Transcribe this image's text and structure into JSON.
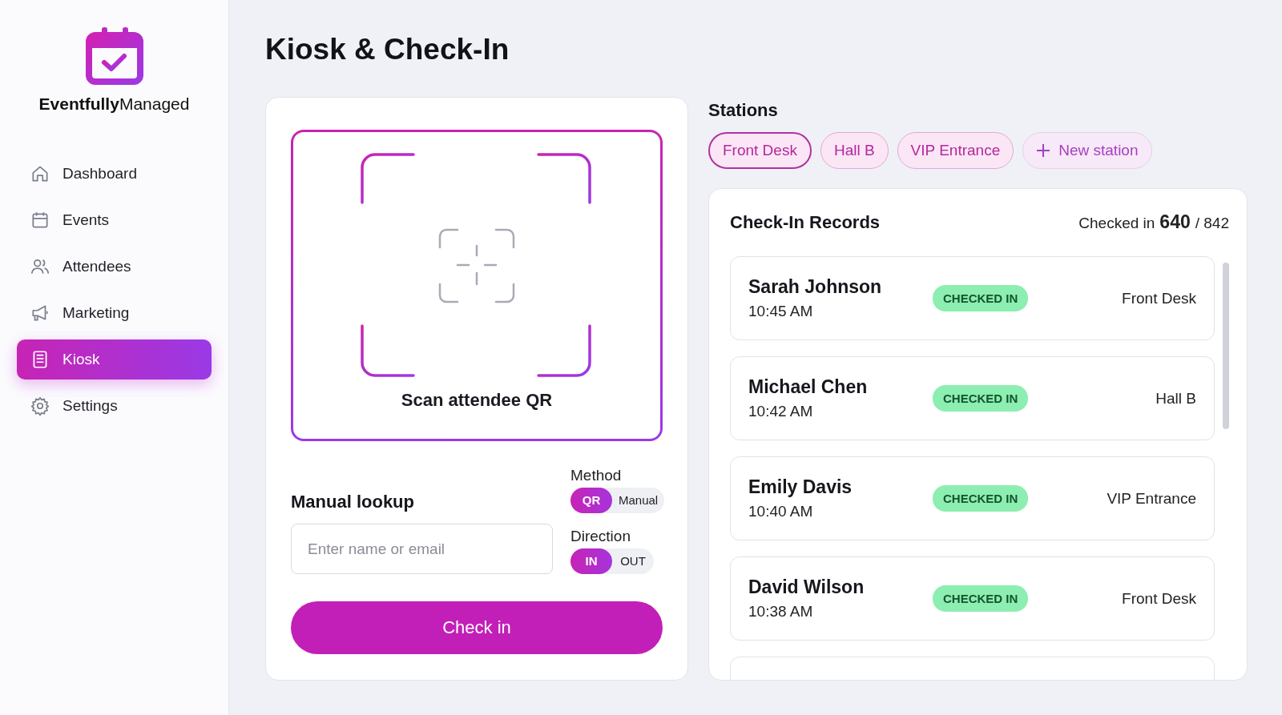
{
  "brand": {
    "name_bold": "Eventfully",
    "name_rest": "Managed"
  },
  "nav": [
    {
      "label": "Dashboard",
      "kind": "home",
      "selected": false
    },
    {
      "label": "Events",
      "kind": "calendar",
      "selected": false
    },
    {
      "label": "Attendees",
      "kind": "users",
      "selected": false
    },
    {
      "label": "Marketing",
      "kind": "megaphone",
      "selected": false
    },
    {
      "label": "Kiosk",
      "kind": "kiosk",
      "selected": true
    },
    {
      "label": "Settings",
      "kind": "gear",
      "selected": false
    }
  ],
  "page_title": "Kiosk & Check-In",
  "scanner": {
    "caption": "Scan attendee QR"
  },
  "manual_lookup": {
    "title": "Manual lookup",
    "placeholder": "Enter name or email"
  },
  "method": {
    "label": "Method",
    "options": [
      {
        "label": "QR",
        "selected": true
      },
      {
        "label": "Manual",
        "selected": false
      }
    ]
  },
  "direction": {
    "label": "Direction",
    "options": [
      {
        "label": "IN",
        "selected": true
      },
      {
        "label": "OUT",
        "selected": false
      }
    ]
  },
  "check_in_button": "Check in",
  "stations": {
    "title": "Stations",
    "items": [
      {
        "label": "Front Desk",
        "selected": true
      },
      {
        "label": "Hall B",
        "selected": false
      },
      {
        "label": "VIP Entrance",
        "selected": false
      }
    ],
    "new_button": "New station"
  },
  "records": {
    "title": "Check-In Records",
    "summary_label": "Checked in",
    "checked_count": "640",
    "separator": "/",
    "total": "842",
    "has_more": true,
    "rows": [
      {
        "name": "Sarah Johnson",
        "time": "10:45 AM",
        "status": "CHECKED IN",
        "station": "Front Desk"
      },
      {
        "name": "Michael Chen",
        "time": "10:42 AM",
        "status": "CHECKED IN",
        "station": "Hall B"
      },
      {
        "name": "Emily Davis",
        "time": "10:40 AM",
        "status": "CHECKED IN",
        "station": "VIP Entrance"
      },
      {
        "name": "David Wilson",
        "time": "10:38 AM",
        "status": "CHECKED IN",
        "station": "Front Desk"
      }
    ]
  }
}
